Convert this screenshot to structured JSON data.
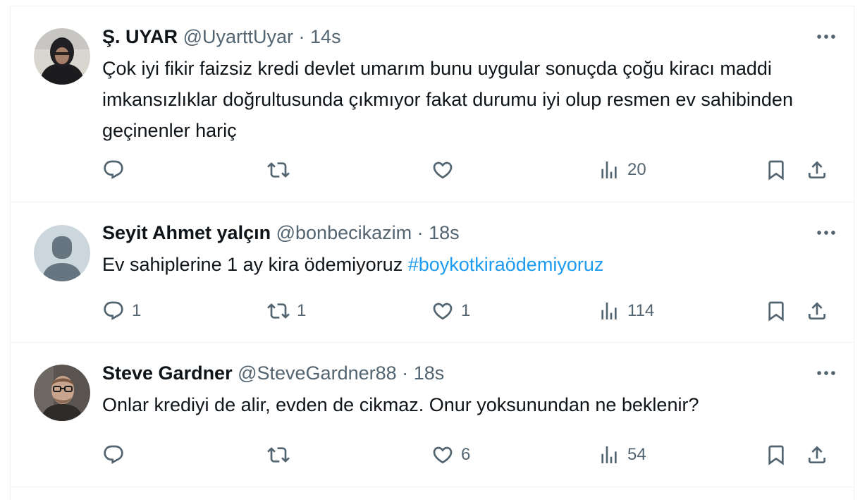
{
  "tweets": [
    {
      "name": "Ş. UYAR",
      "handle": "@UyarttUyar",
      "separator": "·",
      "time": "14s",
      "text": "Çok iyi fikir faizsiz kredi  devlet umarım bunu uygular sonuçda çoğu kiracı maddi imkansızlıklar doğrultusunda çıkmıyor fakat durumu iyi olup resmen ev sahibinden geçinenler hariç",
      "hashtag": "",
      "replies": "",
      "reposts": "",
      "likes": "",
      "views": "20",
      "avatar": "user-photo-hooded"
    },
    {
      "name": "Seyit Ahmet yalçın",
      "handle": "@bonbecikazim",
      "separator": "·",
      "time": "18s",
      "text": "Ev sahiplerine 1 ay kira ödemiyoruz ",
      "hashtag": "#boykotkiraödemiyoruz",
      "replies": "1",
      "reposts": "1",
      "likes": "1",
      "views": "114",
      "avatar": "default-avatar"
    },
    {
      "name": "Steve Gardner",
      "handle": "@SteveGardner88",
      "separator": "·",
      "time": "18s",
      "text": "Onlar krediyi de alir, evden de cikmaz. Onur yoksunundan ne beklenir?",
      "hashtag": "",
      "replies": "",
      "reposts": "",
      "likes": "6",
      "views": "54",
      "avatar": "user-photo-glasses"
    }
  ],
  "colors": {
    "accent": "#1d9bf0",
    "text_primary": "#0f1419",
    "text_secondary": "#536471",
    "divider": "#eff3f4"
  },
  "icons": [
    "reply-icon",
    "repost-icon",
    "like-icon",
    "views-icon",
    "bookmark-icon",
    "share-icon",
    "more-icon"
  ]
}
